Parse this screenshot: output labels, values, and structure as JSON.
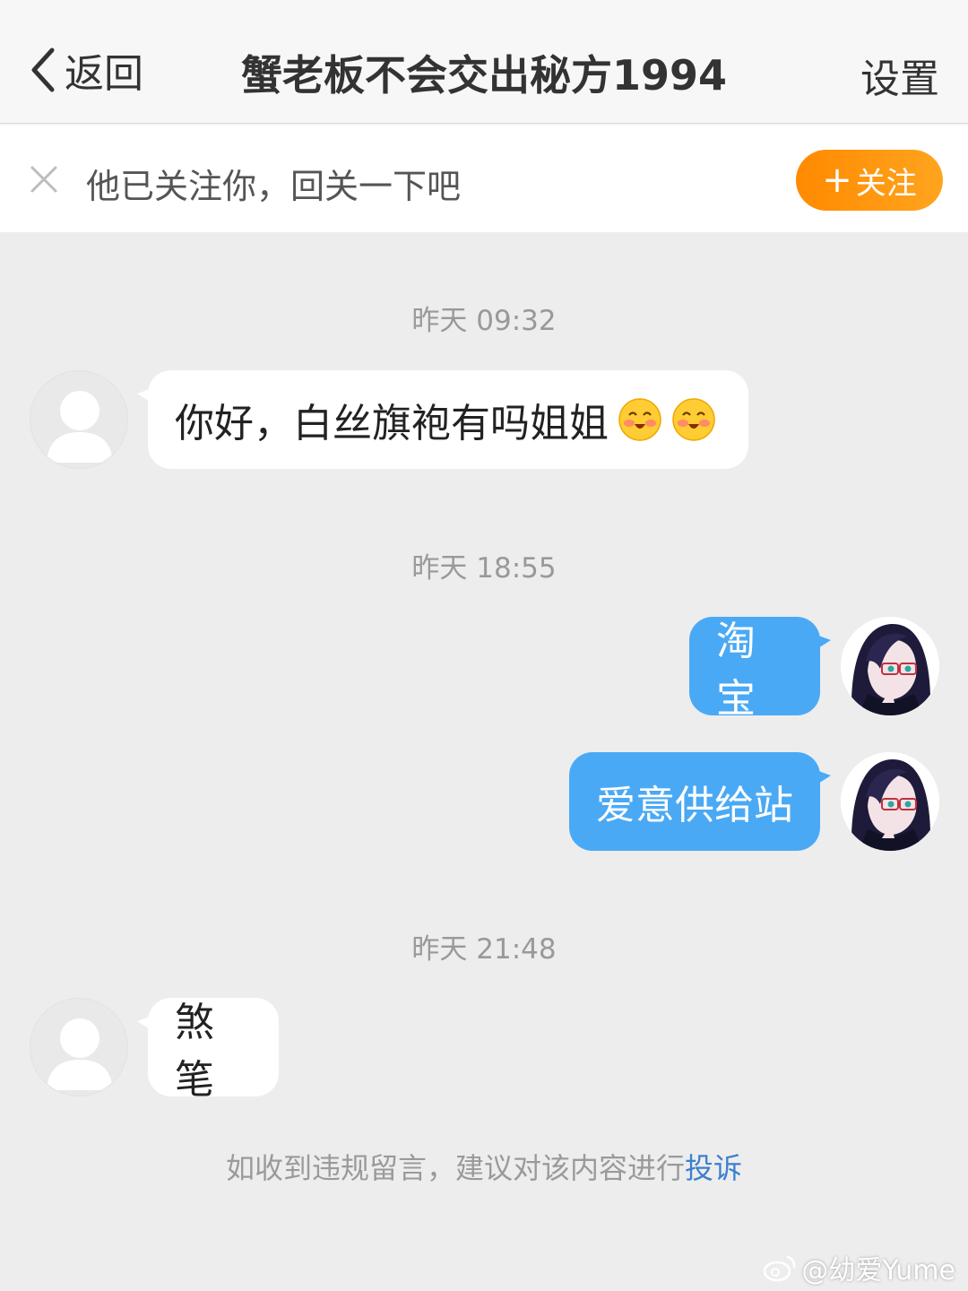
{
  "header": {
    "back_label": "返回",
    "title": "蟹老板不会交出秘方1994",
    "settings_label": "设置"
  },
  "follow_bar": {
    "tip": "他已关注你，回关一下吧",
    "follow_plus": "+",
    "follow_label": "关注"
  },
  "messages": {
    "t1": "昨天 09:32",
    "m1": "你好，白丝旗袍有吗姐姐",
    "t2": "昨天 18:55",
    "m2": "淘宝",
    "m3": "爱意供给站",
    "t3": "昨天 21:48",
    "m4": "煞笔"
  },
  "notice": {
    "text": "如收到违规留言，建议对该内容进行",
    "link": "投诉"
  },
  "watermark": "@幼爱Yume",
  "colors": {
    "accent_orange": "#ff8a00",
    "outgoing_bubble": "#4aa9f5",
    "link_blue": "#3d7fcf"
  }
}
